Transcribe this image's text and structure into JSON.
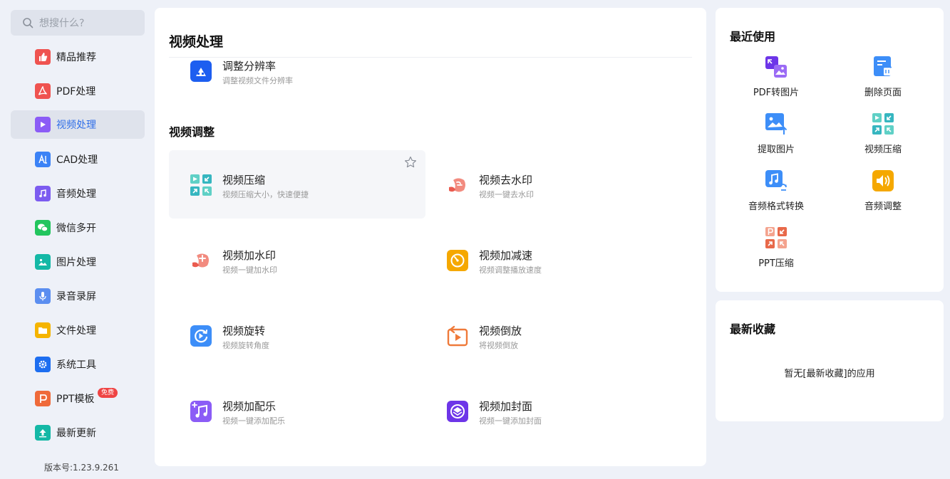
{
  "search": {
    "placeholder": "想搜什么?",
    "icon": "search-icon"
  },
  "sidebar": {
    "items": [
      {
        "label": "精品推荐",
        "icon": "thumbs-up-icon",
        "color": "#ef5350"
      },
      {
        "label": "PDF处理",
        "icon": "pdf-icon",
        "color": "#ef5350"
      },
      {
        "label": "视频处理",
        "icon": "play-icon",
        "color": "#8b5cf6",
        "active": true
      },
      {
        "label": "CAD处理",
        "icon": "cad-icon",
        "color": "#3b82f6"
      },
      {
        "label": "音频处理",
        "icon": "music-note-icon",
        "color": "#7c5cf0"
      },
      {
        "label": "微信多开",
        "icon": "wechat-icon",
        "color": "#22c55e"
      },
      {
        "label": "图片处理",
        "icon": "image-icon",
        "color": "#14b8a6"
      },
      {
        "label": "录音录屏",
        "icon": "microphone-icon",
        "color": "#5b8ef0"
      },
      {
        "label": "文件处理",
        "icon": "folder-icon",
        "color": "#f5b400"
      },
      {
        "label": "系统工具",
        "icon": "gear-icon",
        "color": "#1d6ef0"
      },
      {
        "label": "PPT模板",
        "icon": "ppt-icon",
        "color": "#ef6a3a",
        "badge": "免费"
      },
      {
        "label": "最新更新",
        "icon": "upload-icon",
        "color": "#14b8a6"
      }
    ],
    "version": "版本号:1.23.9.261"
  },
  "main": {
    "title": "视频处理",
    "partial_item": {
      "name": "调整分辨率",
      "desc": "调整视频文件分辨率",
      "icon": "resolution-icon"
    },
    "section_title": "视频调整",
    "tools": [
      {
        "name": "视频压缩",
        "desc": "视频压缩大小，快速便捷",
        "icon": "video-compress-icon"
      },
      {
        "name": "视频去水印",
        "desc": "视频一键去水印",
        "icon": "remove-watermark-icon"
      },
      {
        "name": "视频加水印",
        "desc": "视频一键加水印",
        "icon": "add-watermark-icon"
      },
      {
        "name": "视频加减速",
        "desc": "视频调整播放速度",
        "icon": "speed-icon"
      },
      {
        "name": "视频旋转",
        "desc": "视频旋转角度",
        "icon": "rotate-icon"
      },
      {
        "name": "视频倒放",
        "desc": "将视频倒放",
        "icon": "reverse-icon"
      },
      {
        "name": "视频加配乐",
        "desc": "视频一键添加配乐",
        "icon": "add-music-icon"
      },
      {
        "name": "视频加封面",
        "desc": "视频一键添加封面",
        "icon": "add-cover-icon"
      }
    ]
  },
  "recent": {
    "title": "最近使用",
    "items": [
      {
        "label": "PDF转图片",
        "icon": "pdf-to-image-icon"
      },
      {
        "label": "删除页面",
        "icon": "delete-page-icon"
      },
      {
        "label": "提取图片",
        "icon": "extract-image-icon"
      },
      {
        "label": "视频压缩",
        "icon": "video-compress-icon"
      },
      {
        "label": "音频格式转换",
        "icon": "audio-convert-icon"
      },
      {
        "label": "音频调整",
        "icon": "audio-adjust-icon"
      },
      {
        "label": "PPT压缩",
        "icon": "ppt-compress-icon"
      }
    ]
  },
  "favorites": {
    "title": "最新收藏",
    "empty_text": "暂无[最新收藏]的应用"
  }
}
